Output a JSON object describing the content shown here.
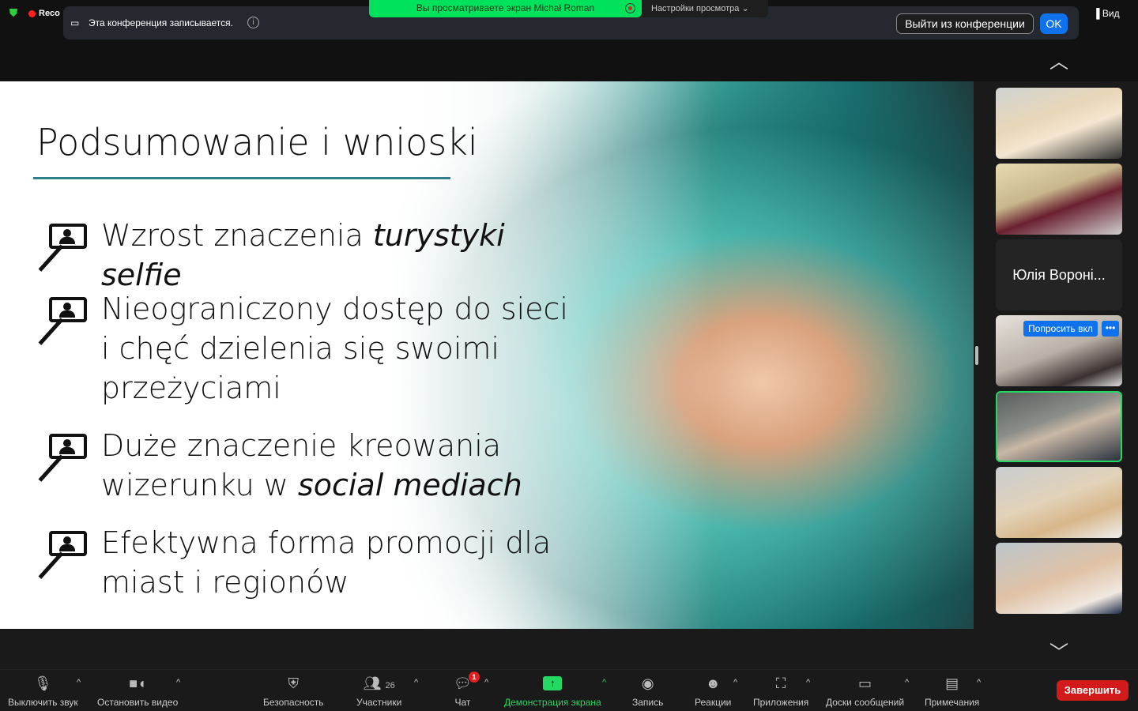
{
  "top": {
    "recording_label": "Reco",
    "recording_notice": "Эта конференция записывается.",
    "leave_button": "Выйти из конференции",
    "ok_button": "OK",
    "share_notice": "Вы просматриваете экран Michał Roman",
    "view_options": "Настройки просмотра",
    "view_button": "Вид"
  },
  "slide": {
    "title": "Podsumowanie i wnioski",
    "bullets": [
      {
        "parts": [
          "Wzrost znaczenia ",
          "turystyki selfie"
        ]
      },
      {
        "parts": [
          "Nieograniczony dostęp do sieci i chęć dzielenia się swoimi przeżyciami"
        ]
      },
      {
        "parts": [
          "Duże znaczenie kreowania wizerunku w ",
          "social mediach"
        ]
      },
      {
        "parts": [
          "Efektywna forma promocji dla miast i regionów"
        ]
      }
    ]
  },
  "gallery": {
    "name_tile": "Юлія Вороні...",
    "ask_button": "Попросить вкл",
    "more_button": "•••"
  },
  "toolbar": {
    "mute": "Выключить звук",
    "video": "Остановить видео",
    "security": "Безопасность",
    "participants": "Участники",
    "participants_count": "26",
    "chat": "Чат",
    "chat_badge": "1",
    "share": "Демонстрация экрана",
    "record": "Запись",
    "reactions": "Реакции",
    "apps": "Приложения",
    "whiteboards": "Доски сообщений",
    "notes": "Примечания",
    "end": "Завершить"
  },
  "colors": {
    "share_green": "#00e25b",
    "accent_blue": "#0e72ed",
    "end_red": "#d21a1a",
    "title_rule": "#2f7f8a"
  }
}
